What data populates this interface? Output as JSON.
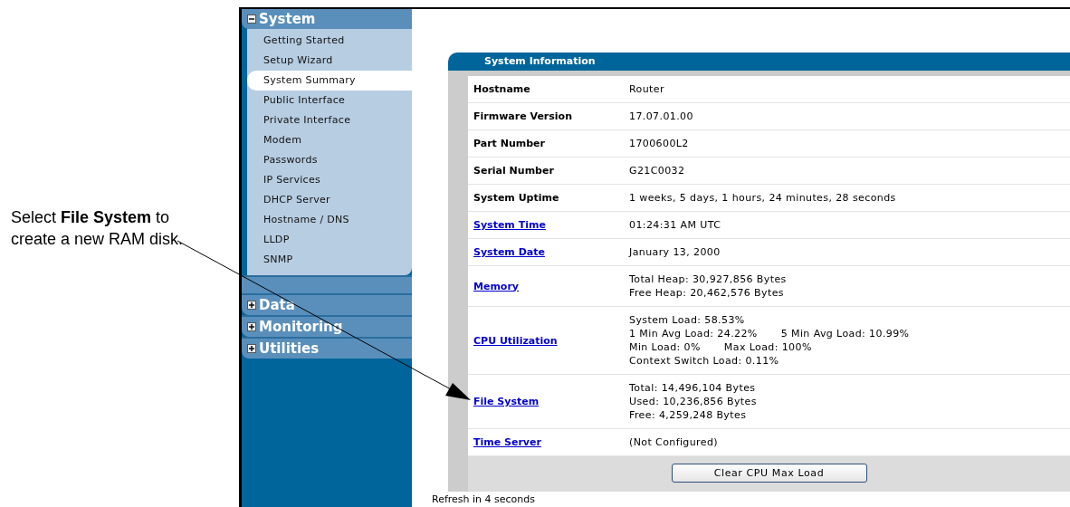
{
  "annotation": {
    "text": "Select **File System** to create a new RAM disk."
  },
  "sidebar": {
    "sections": [
      {
        "label": "System",
        "expanded": true,
        "items": [
          {
            "label": "Getting Started",
            "selected": false
          },
          {
            "label": "Setup Wizard",
            "selected": false
          },
          {
            "label": "System Summary",
            "selected": true
          },
          {
            "label": "Public Interface",
            "selected": false
          },
          {
            "label": "Private Interface",
            "selected": false
          },
          {
            "label": "Modem",
            "selected": false
          },
          {
            "label": "Passwords",
            "selected": false
          },
          {
            "label": "IP Services",
            "selected": false
          },
          {
            "label": "DHCP Server",
            "selected": false
          },
          {
            "label": "Hostname / DNS",
            "selected": false
          },
          {
            "label": "LLDP",
            "selected": false
          },
          {
            "label": "SNMP",
            "selected": false
          }
        ]
      },
      {
        "label": "Data",
        "expanded": false
      },
      {
        "label": "Monitoring",
        "expanded": false
      },
      {
        "label": "Utilities",
        "expanded": false
      }
    ]
  },
  "panel": {
    "title": "System Information",
    "rows": [
      {
        "label": "Hostname",
        "kind": "plain",
        "lines": [
          [
            "Router"
          ]
        ]
      },
      {
        "label": "Firmware Version",
        "kind": "plain",
        "lines": [
          [
            "17.07.01.00"
          ]
        ]
      },
      {
        "label": "Part Number",
        "kind": "plain",
        "lines": [
          [
            "1700600L2"
          ]
        ]
      },
      {
        "label": "Serial Number",
        "kind": "plain",
        "lines": [
          [
            "G21C0032"
          ]
        ]
      },
      {
        "label": "System Uptime",
        "kind": "plain",
        "lines": [
          [
            "1 weeks, 5 days, 1 hours, 24 minutes, 28 seconds"
          ]
        ]
      },
      {
        "label": "System Time",
        "kind": "link",
        "lines": [
          [
            "01:24:31 AM UTC"
          ]
        ]
      },
      {
        "label": "System Date",
        "kind": "link",
        "lines": [
          [
            "January 13, 2000"
          ]
        ]
      },
      {
        "label": "Memory",
        "kind": "link",
        "lines": [
          [
            "Total Heap: 30,927,856 Bytes"
          ],
          [
            "Free Heap: 20,462,576 Bytes"
          ]
        ]
      },
      {
        "label": "CPU Utilization",
        "kind": "link",
        "lines": [
          [
            "System Load: 58.53%"
          ],
          [
            "1 Min Avg Load: 24.22%",
            "5 Min Avg Load: 10.99%"
          ],
          [
            "Min Load: 0%",
            "Max Load: 100%"
          ],
          [
            "Context Switch Load: 0.11%"
          ]
        ]
      },
      {
        "label": "File System",
        "kind": "link",
        "lines": [
          [
            "Total: 14,496,104 Bytes"
          ],
          [
            "Used: 10,236,856 Bytes"
          ],
          [
            "Free: 4,259,248 Bytes"
          ]
        ]
      },
      {
        "label": "Time Server",
        "kind": "link",
        "lines": [
          [
            "(Not Configured)"
          ]
        ]
      }
    ],
    "button": "Clear CPU Max Load"
  },
  "status": "Refresh in 4 seconds"
}
